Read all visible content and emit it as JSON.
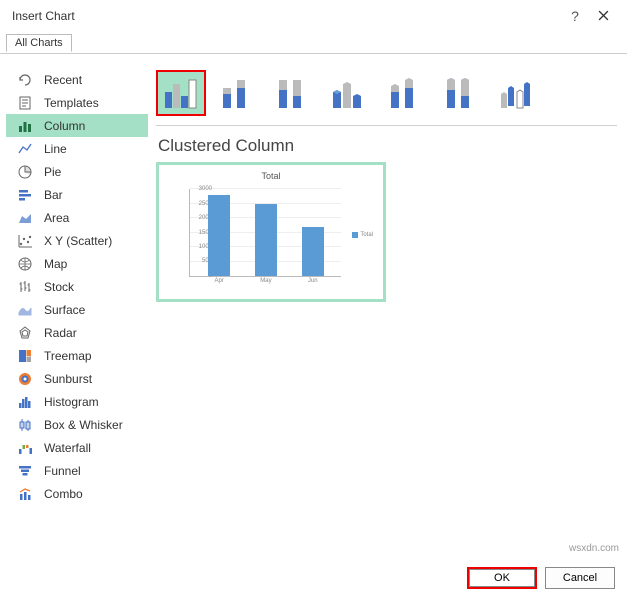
{
  "titlebar": {
    "title": "Insert Chart",
    "help": "?"
  },
  "tab_label": "All Charts",
  "sidebar": {
    "items": [
      {
        "label": "Recent"
      },
      {
        "label": "Templates"
      },
      {
        "label": "Column"
      },
      {
        "label": "Line"
      },
      {
        "label": "Pie"
      },
      {
        "label": "Bar"
      },
      {
        "label": "Area"
      },
      {
        "label": "X Y (Scatter)"
      },
      {
        "label": "Map"
      },
      {
        "label": "Stock"
      },
      {
        "label": "Surface"
      },
      {
        "label": "Radar"
      },
      {
        "label": "Treemap"
      },
      {
        "label": "Sunburst"
      },
      {
        "label": "Histogram"
      },
      {
        "label": "Box & Whisker"
      },
      {
        "label": "Waterfall"
      },
      {
        "label": "Funnel"
      },
      {
        "label": "Combo"
      }
    ]
  },
  "chart_name": "Clustered Column",
  "buttons": {
    "ok": "OK",
    "cancel": "Cancel"
  },
  "watermark": "wsxdn.com",
  "chart_data": {
    "type": "bar",
    "title": "Total",
    "categories": [
      "Apr",
      "May",
      "Jun"
    ],
    "values": [
      2800,
      2500,
      1700
    ],
    "series_name": "Total",
    "ylabel": "",
    "xlabel": "",
    "ylim": [
      0,
      3000
    ],
    "yticks": [
      0,
      500,
      1000,
      1500,
      2000,
      2500,
      3000
    ]
  }
}
